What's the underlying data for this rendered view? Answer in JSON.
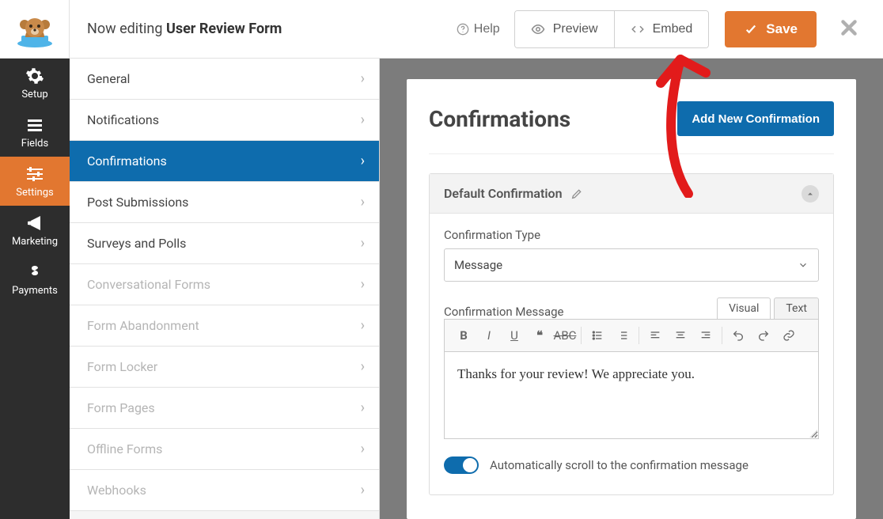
{
  "header": {
    "editing_prefix": "Now editing ",
    "form_name": "User Review Form",
    "help_label": "Help",
    "preview_label": "Preview",
    "embed_label": "Embed",
    "save_label": "Save"
  },
  "vnav": {
    "items": [
      {
        "id": "setup",
        "label": "Setup",
        "icon": "gear"
      },
      {
        "id": "fields",
        "label": "Fields",
        "icon": "list"
      },
      {
        "id": "settings",
        "label": "Settings",
        "icon": "sliders",
        "active": true
      },
      {
        "id": "marketing",
        "label": "Marketing",
        "icon": "megaphone"
      },
      {
        "id": "payments",
        "label": "Payments",
        "icon": "dollar"
      }
    ]
  },
  "settings_menu": {
    "items": [
      {
        "label": "General"
      },
      {
        "label": "Notifications"
      },
      {
        "label": "Confirmations",
        "active": true
      },
      {
        "label": "Post Submissions"
      },
      {
        "label": "Surveys and Polls"
      },
      {
        "label": "Conversational Forms",
        "disabled": true
      },
      {
        "label": "Form Abandonment",
        "disabled": true
      },
      {
        "label": "Form Locker",
        "disabled": true
      },
      {
        "label": "Form Pages",
        "disabled": true
      },
      {
        "label": "Offline Forms",
        "disabled": true
      },
      {
        "label": "Webhooks",
        "disabled": true
      }
    ]
  },
  "main": {
    "title": "Confirmations",
    "add_button": "Add New Confirmation",
    "card": {
      "name": "Default Confirmation",
      "type_label": "Confirmation Type",
      "type_value": "Message",
      "message_label": "Confirmation Message",
      "visual_tab": "Visual",
      "text_tab": "Text",
      "message_body": "Thanks for your review! We appreciate you.",
      "scroll_label": "Automatically scroll to the confirmation message",
      "scroll_enabled": true
    }
  }
}
